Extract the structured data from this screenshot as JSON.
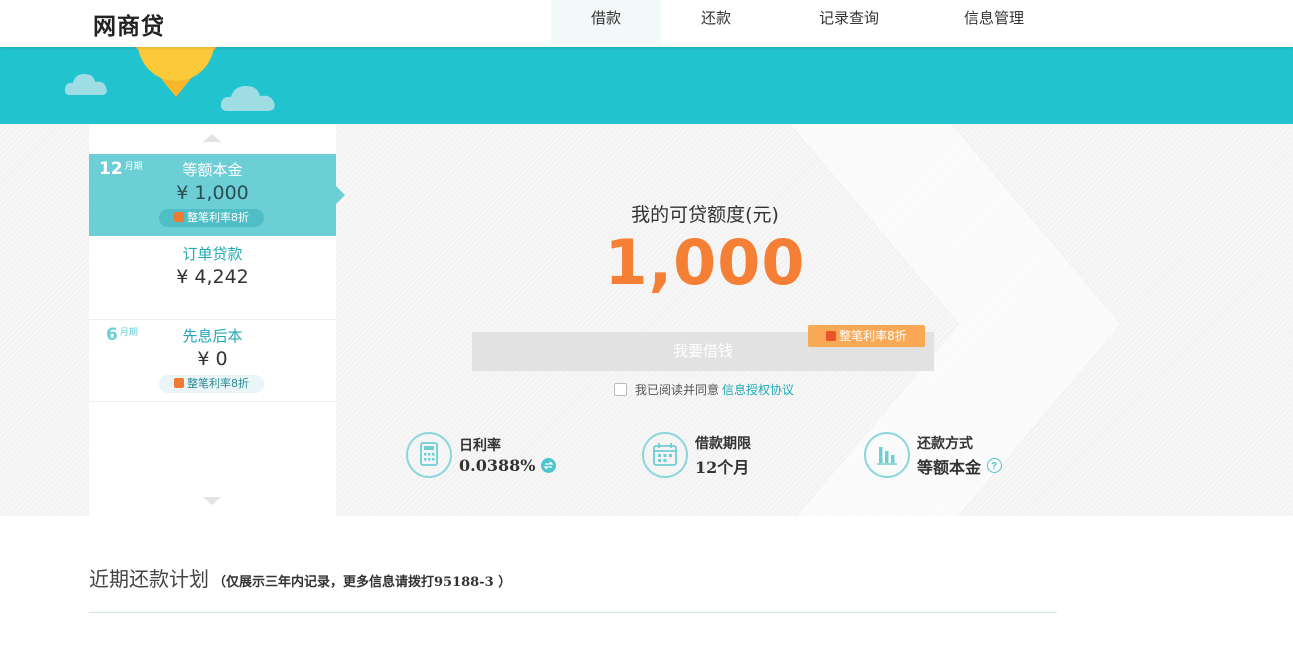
{
  "header": {
    "logo": "网商贷",
    "nav": [
      {
        "label": "借款",
        "active": true
      },
      {
        "label": "还款",
        "active": false
      },
      {
        "label": "记录查询",
        "active": false
      },
      {
        "label": "信息管理",
        "active": false
      }
    ]
  },
  "products": [
    {
      "term_num": "12",
      "term_unit": "月期",
      "name": "等额本金",
      "amount": "¥ 1,000",
      "promo": "整笔利率8折",
      "selected": true
    },
    {
      "term_num": "",
      "term_unit": "",
      "name": "订单贷款",
      "amount": "¥ 4,242",
      "promo": "",
      "selected": false
    },
    {
      "term_num": "6",
      "term_unit": "月期",
      "name": "先息后本",
      "amount": "¥ 0",
      "promo": "整笔利率8折",
      "selected": false
    }
  ],
  "loan": {
    "quota_label": "我的可贷额度(元)",
    "quota_value": "1,000",
    "borrow_button": "我要借钱",
    "button_tag": "整笔利率8折",
    "agree_text": "我已阅读并同意",
    "agree_link": "信息授权协议"
  },
  "info": [
    {
      "title": "日利率",
      "value": "0.0388%",
      "icon": "calculator-icon",
      "extra_icon": "exchange-icon"
    },
    {
      "title": "借款期限",
      "value": "12个月",
      "icon": "calendar-icon",
      "extra_icon": ""
    },
    {
      "title": "还款方式",
      "value": "等额本金",
      "icon": "bar-chart-icon",
      "extra_icon": "help-icon"
    }
  ],
  "plan": {
    "title": "近期还款计划",
    "note": "（仅展示三年内记录，更多信息请拨打95188-3 ）"
  },
  "colors": {
    "teal": "#21c3cf",
    "selected_bg": "#6ccfd6",
    "accent_orange": "#f47f35",
    "link": "#20a9b5"
  }
}
